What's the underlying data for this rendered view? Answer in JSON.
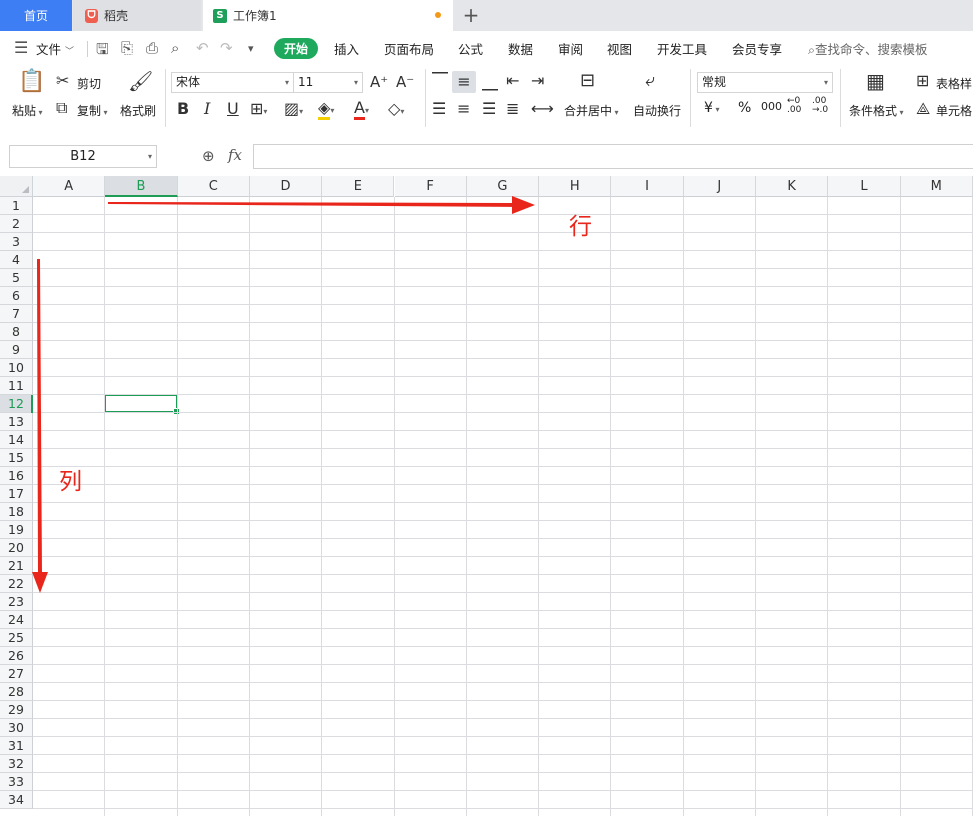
{
  "tabs": {
    "home": "首页",
    "docer": "稻壳",
    "workbook": "工作簿1",
    "add": "+"
  },
  "menu": {
    "file": "文件",
    "items": [
      "开始",
      "插入",
      "页面布局",
      "公式",
      "数据",
      "审阅",
      "视图",
      "开发工具",
      "会员专享"
    ],
    "search": "查找命令、搜索模板"
  },
  "ribbon": {
    "paste": "粘贴",
    "cut": "剪切",
    "copy": "复制",
    "format_painter": "格式刷",
    "font_name": "宋体",
    "font_size": "11",
    "merge_center": "合并居中",
    "wrap_text": "自动换行",
    "number_format": "常规",
    "currency": "¥",
    "percent": "%",
    "thousands": "000",
    "dec_increase": "←0 .00",
    "dec_decrease": ".00 →.0",
    "cond_format": "条件格式",
    "table_style": "表格样",
    "cell_style": "单元格"
  },
  "formula_bar": {
    "name_box": "B12",
    "fx": "fx",
    "value": ""
  },
  "grid": {
    "columns": [
      "A",
      "B",
      "C",
      "D",
      "E",
      "F",
      "G",
      "H",
      "I",
      "J",
      "K",
      "L",
      "M"
    ],
    "active_column": "B",
    "active_row": 12,
    "row_count": 34
  },
  "annotations": {
    "row_label": "行",
    "col_label": "列",
    "arrow_color": "#e8261b"
  },
  "colors": {
    "accent": "#1ea95c",
    "home_tab": "#3e7ef5"
  }
}
